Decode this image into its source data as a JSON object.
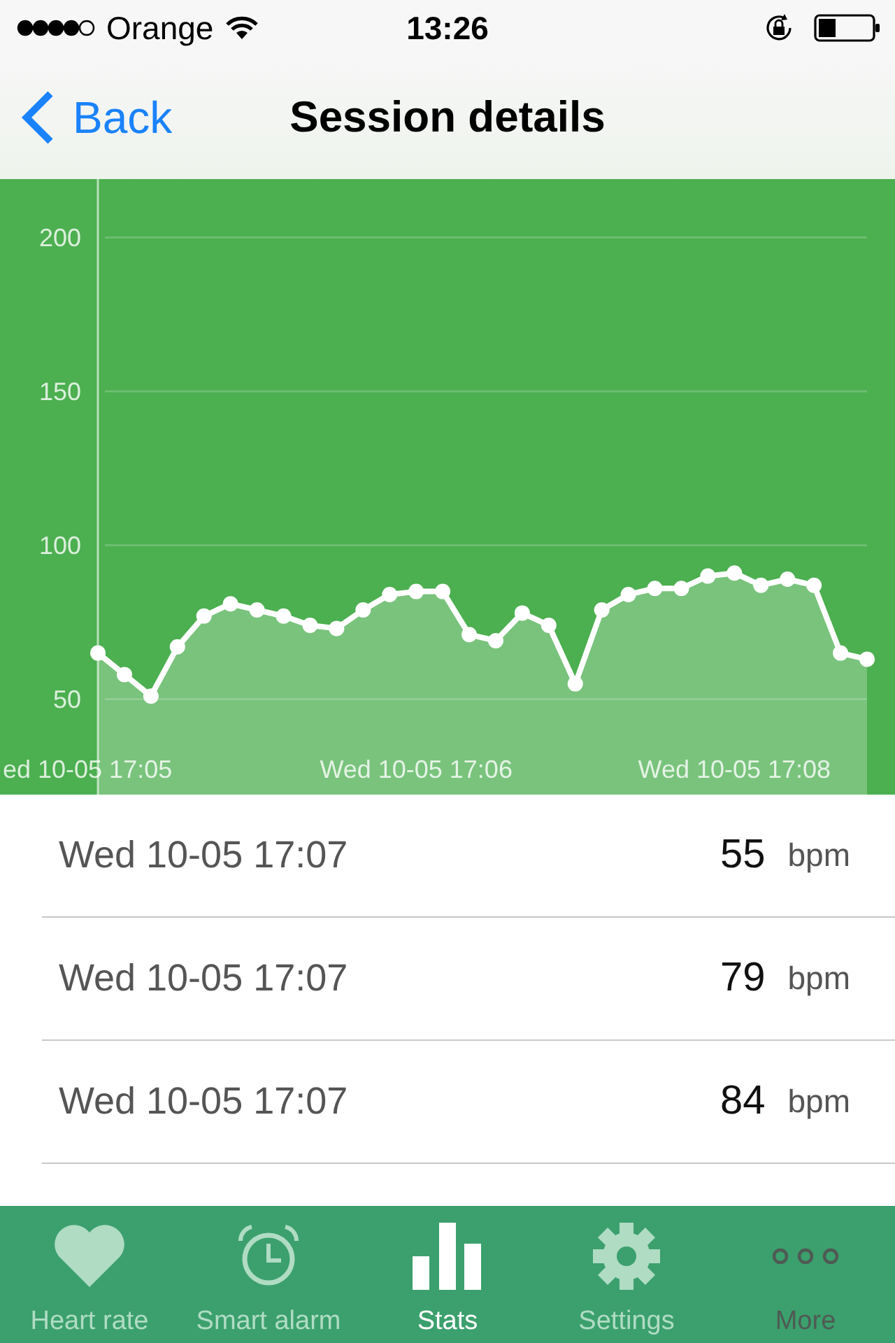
{
  "status_bar": {
    "carrier": "Orange",
    "time": "13:26"
  },
  "nav": {
    "back": "Back",
    "title": "Session details"
  },
  "chart": {
    "chart_data": {
      "type": "area",
      "grid": true,
      "categories": [
        "ed 10-05 17:05",
        null,
        null,
        null,
        null,
        null,
        null,
        null,
        null,
        null,
        null,
        null,
        "Wed 10-05 17:06",
        null,
        null,
        null,
        null,
        null,
        null,
        null,
        null,
        null,
        null,
        null,
        "Wed 10-05 17:08",
        null,
        null,
        null,
        null,
        null
      ],
      "series": [
        {
          "color": "#ffffff",
          "values": [
            65,
            58,
            51,
            67,
            77,
            81,
            79,
            77,
            74,
            73,
            79,
            84,
            85,
            85,
            71,
            69,
            78,
            74,
            55,
            79,
            84,
            86,
            86,
            90,
            91,
            87,
            89,
            87,
            65,
            63
          ]
        }
      ],
      "ylim": [
        19,
        219
      ],
      "yticks": [
        50,
        100,
        150,
        200
      ]
    }
  },
  "rows": [
    {
      "time": "Wed 10-05 17:07",
      "value": "55",
      "unit": "bpm"
    },
    {
      "time": "Wed 10-05 17:07",
      "value": "79",
      "unit": "bpm"
    },
    {
      "time": "Wed 10-05 17:07",
      "value": "84",
      "unit": "bpm"
    }
  ],
  "tabs": [
    {
      "kind": "heart",
      "label": "Heart rate",
      "selected": false,
      "disabled": false
    },
    {
      "kind": "alarm",
      "label": "Smart alarm",
      "selected": false,
      "disabled": false
    },
    {
      "kind": "stats",
      "label": "Stats",
      "selected": true,
      "disabled": false
    },
    {
      "kind": "settings",
      "label": "Settings",
      "selected": false,
      "disabled": false
    },
    {
      "kind": "more",
      "label": "More",
      "selected": false,
      "disabled": true
    }
  ]
}
